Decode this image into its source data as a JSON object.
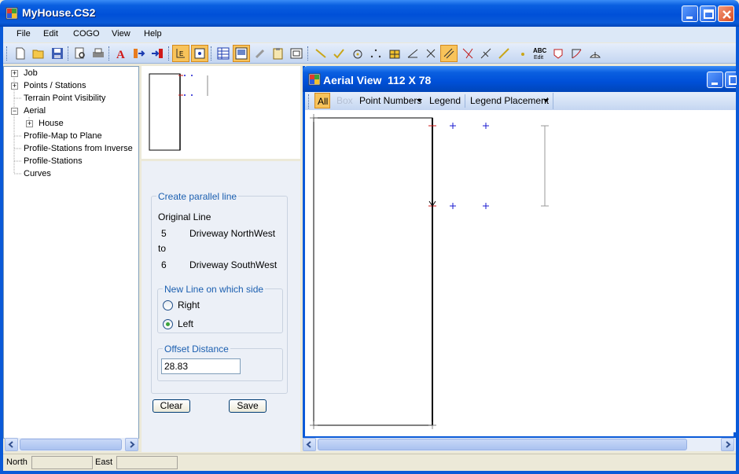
{
  "window": {
    "title": "MyHouse.CS2"
  },
  "menu": [
    "File",
    "Edit",
    "COGO",
    "View",
    "Help"
  ],
  "toolbar": {
    "icons": [
      "new-file-icon",
      "open-folder-icon",
      "save-icon",
      "print-preview-icon",
      "print-icon",
      "text-style-icon",
      "import-icon",
      "export-icon",
      "select-icon",
      "fit-icon",
      "table-icon",
      "panel-icon",
      "tools-icon",
      "clipboard-icon",
      "window-icon",
      "line-icon",
      "check-line-icon",
      "circle-point-icon",
      "points-icon",
      "grid-icon",
      "angle-icon",
      "cross-icon",
      "offset-line-icon",
      "intersect-icon",
      "perpendicular-icon",
      "measure-icon",
      "dot-icon",
      "abc-edit-icon",
      "area-icon",
      "arc-icon",
      "curve-icon"
    ],
    "abc_label": "ABC",
    "edit_label": "Edit"
  },
  "tree": {
    "items": [
      {
        "label": "Job",
        "expander": "+"
      },
      {
        "label": "Points / Stations",
        "expander": "+"
      },
      {
        "label": "Terrain Point Visibility",
        "expander": ""
      },
      {
        "label": "Aerial",
        "expander": "−"
      },
      {
        "label": "House",
        "expander": "+"
      },
      {
        "label": "Profile-Map to Plane",
        "expander": ""
      },
      {
        "label": "Profile-Stations from Inverse",
        "expander": ""
      },
      {
        "label": "Profile-Stations",
        "expander": ""
      },
      {
        "label": "Curves",
        "expander": ""
      }
    ]
  },
  "parallel": {
    "group_title": "Create parallel line",
    "original_line_label": "Original Line",
    "from_number": "5",
    "from_name": "Driveway NorthWest",
    "to_label": "to",
    "to_number": "6",
    "to_name": "Driveway SouthWest",
    "side_group_title": "New Line on which side",
    "side_right": "Right",
    "side_left": "Left",
    "selected_side": "Left",
    "offset_group_title": "Offset Distance",
    "offset_value": "28.83",
    "clear_label": "Clear",
    "save_label": "Save"
  },
  "aerial": {
    "title": "Aerial View",
    "dims": "112  X  78",
    "toolbar": {
      "all": "All",
      "box": "Box",
      "point_numbers": "Point Numbers",
      "legend": "Legend",
      "legend_placement": "Legend Placement"
    }
  },
  "status": {
    "north_label": "North",
    "east_label": "East"
  },
  "colors": {
    "titlebar": "#0a5ad8",
    "accent": "#1b5fb0",
    "point_blue": "#1a1ad0",
    "point_red": "#d01a1a"
  }
}
